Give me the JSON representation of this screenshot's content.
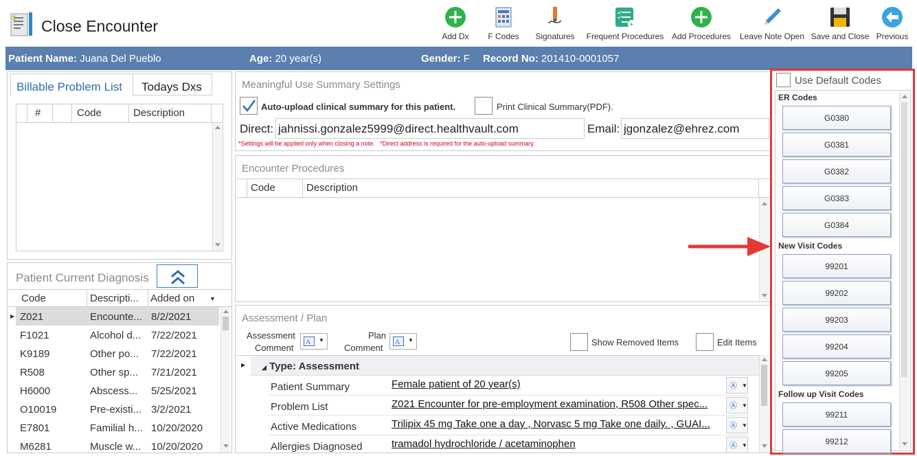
{
  "app": {
    "title": "Close Encounter"
  },
  "toolbar": {
    "add_dx": "Add Dx",
    "f_codes": "F Codes",
    "signatures": "Signatures",
    "frequent_procedures": "Frequent Procedures",
    "add_procedures": "Add Procedures",
    "leave_note_open": "Leave Note Open",
    "save_and_close": "Save and Close",
    "previous": "Previous"
  },
  "patient": {
    "name_label": "Patient Name:",
    "name": "Juana Del Pueblo",
    "age_label": "Age:",
    "age": "20 year(s)",
    "gender_label": "Gender:",
    "gender": "F",
    "record_label": "Record No:",
    "record": "201410-0001057"
  },
  "problem_tabs": {
    "tab1": "Billable Problem List",
    "tab2": "Todays Dxs"
  },
  "problem_grid": {
    "col_num": "#",
    "col_code": "Code",
    "col_desc": "Description"
  },
  "diagnosis": {
    "title": "Patient Current Diagnosis",
    "col_code": "Code",
    "col_desc": "Descripti...",
    "col_added": "Added on",
    "rows": [
      {
        "code": "Z021",
        "desc": "Encounte...",
        "date": "8/2/2021"
      },
      {
        "code": "F1021",
        "desc": "Alcohol d...",
        "date": "7/22/2021"
      },
      {
        "code": "K9189",
        "desc": "Other po...",
        "date": "7/22/2021"
      },
      {
        "code": "R508",
        "desc": "Other sp...",
        "date": "7/21/2021"
      },
      {
        "code": "H6000",
        "desc": "Abscess...",
        "date": "5/25/2021"
      },
      {
        "code": "O10019",
        "desc": "Pre-existi...",
        "date": "3/2/2021"
      },
      {
        "code": "E7801",
        "desc": "Familial h...",
        "date": "10/20/2020"
      },
      {
        "code": "M6281",
        "desc": "Muscle w...",
        "date": "10/20/2020"
      }
    ]
  },
  "mu": {
    "title": "Meaningful Use Summary Settings",
    "auto_upload": "Auto-upload clinical summary for this patient.",
    "print_summary": "Print Clinical Summary(PDF).",
    "direct_label": "Direct:",
    "direct_value": "jahnissi.gonzalez5999@direct.healthvault.com",
    "email_label": "Email:",
    "email_value": "jgonzalez@ehrez.com",
    "note": "*Settings will be applied only when closing a note.   *Direct address is required for the auto-upload summary."
  },
  "procedures": {
    "title": "Encounter Procedures",
    "col_code": "Code",
    "col_desc": "Description"
  },
  "assessment": {
    "title": "Assessment / Plan",
    "assessment_comment": [
      "Assessment",
      "Comment"
    ],
    "plan_comment": [
      "Plan",
      "Comment"
    ],
    "show_removed": "Show Removed Items",
    "edit_items": "Edit Items",
    "group": "Type: Assessment",
    "rows": [
      {
        "label": "Patient Summary",
        "value": "Female patient of 20 year(s)"
      },
      {
        "label": "Problem List",
        "value": "Z021 Encounter for pre-employment examination, R508 Other spec..."
      },
      {
        "label": "Active Medications",
        "value": "Trilipix 45 mg Take one a day , Norvasc 5 mg Take one daily.  , GUAI..."
      },
      {
        "label": "Allergies Diagnosed",
        "value": "tramadol hydrochloride / acetaminophen"
      }
    ]
  },
  "codes": {
    "use_default": "Use Default Codes",
    "er_title": "ER Codes",
    "er": [
      "G0380",
      "G0381",
      "G0382",
      "G0383",
      "G0384"
    ],
    "new_title": "New Visit Codes",
    "new": [
      "99201",
      "99202",
      "99203",
      "99204",
      "99205"
    ],
    "follow_title": "Follow up Visit Codes",
    "follow": [
      "99211",
      "99212"
    ]
  },
  "colors": {
    "header_bar": "#5b7fae",
    "highlight_border": "#e53935",
    "add_green": "#2db34a",
    "previous_blue": "#3aa3e3",
    "arrow_red": "#e53935"
  },
  "icons": [
    "add-dx-icon",
    "f-codes-icon",
    "signatures-icon",
    "frequent-procedures-icon",
    "add-procedures-icon",
    "leave-note-open-icon",
    "save-and-close-icon",
    "previous-icon",
    "encounter-logo-icon",
    "double-chevron-up-icon",
    "checkmark-icon",
    "red-arrow-icon"
  ]
}
